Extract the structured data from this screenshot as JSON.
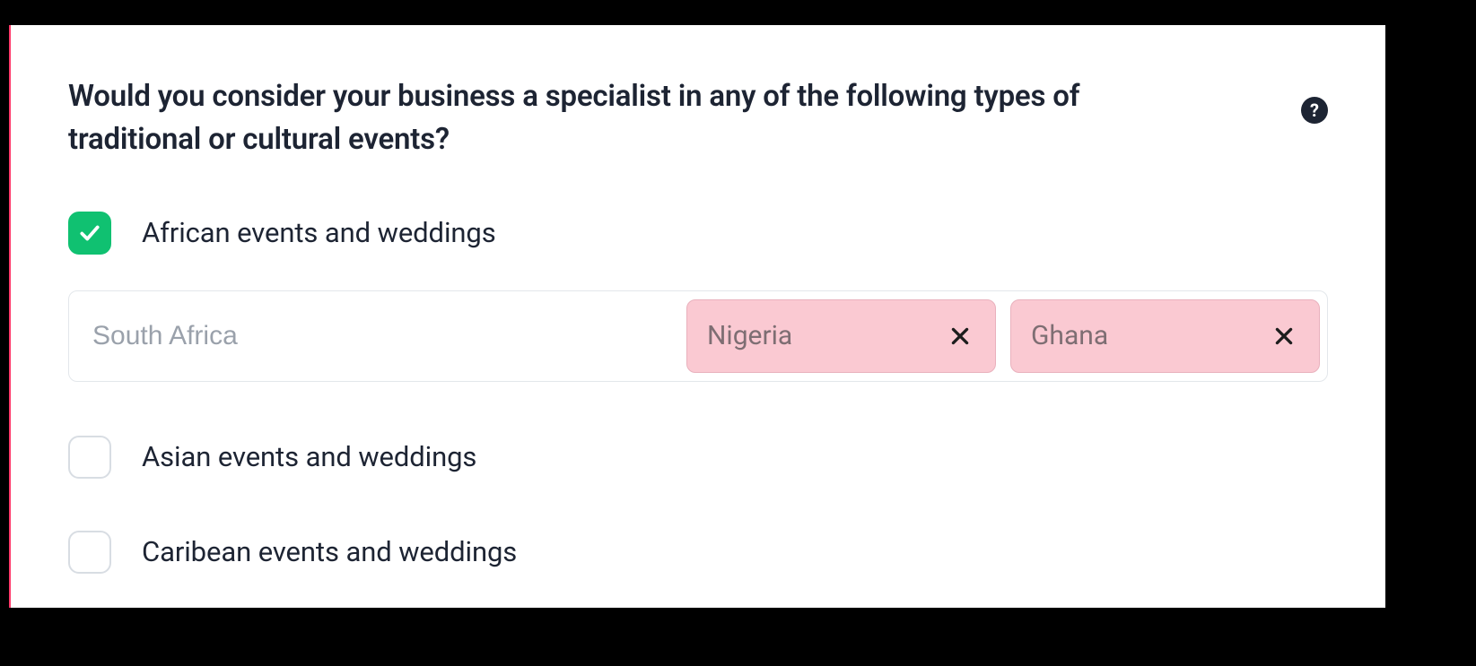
{
  "question": "Would you consider your business a specialist in any of the following types of  traditional or cultural events?",
  "help_glyph": "?",
  "colors": {
    "accent_green": "#10c171",
    "chip_bg": "#fac9d2",
    "card_accent": "#ff3b6b"
  },
  "options": [
    {
      "label": "African events and weddings",
      "checked": true
    },
    {
      "label": "Asian events and weddings",
      "checked": false
    },
    {
      "label": "Caribean events and weddings",
      "checked": false
    }
  ],
  "tag_field": {
    "placeholder": "South Africa",
    "value": "",
    "chips": [
      {
        "label": "Nigeria"
      },
      {
        "label": "Ghana"
      }
    ]
  }
}
